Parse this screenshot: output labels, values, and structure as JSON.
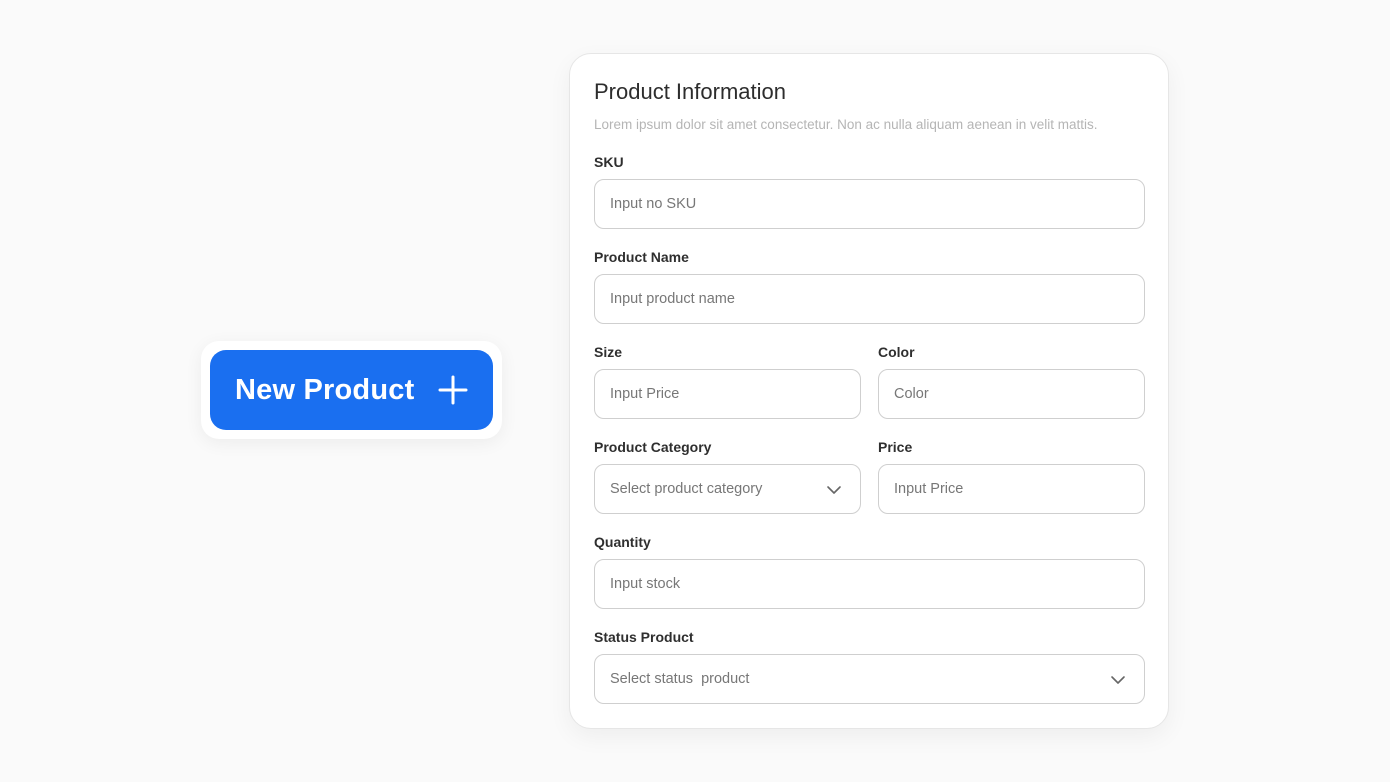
{
  "new_product_button": {
    "label": "New Product",
    "icon": "plus-icon",
    "color": "#1a6ff0"
  },
  "form": {
    "title": "Product Information",
    "subtitle": "Lorem ipsum dolor sit amet consectetur. Non ac nulla aliquam aenean in velit mattis.",
    "fields": {
      "sku": {
        "label": "SKU",
        "placeholder": "Input no SKU"
      },
      "product_name": {
        "label": "Product Name",
        "placeholder": "Input product name"
      },
      "size": {
        "label": "Size",
        "placeholder": "Input Price"
      },
      "color": {
        "label": "Color",
        "placeholder": "Color"
      },
      "category": {
        "label": "Product Category",
        "placeholder": "Select product category",
        "icon": "chevron-down-icon"
      },
      "price": {
        "label": "Price",
        "placeholder": "Input Price"
      },
      "quantity": {
        "label": "Quantity",
        "placeholder": "Input stock"
      },
      "status": {
        "label": "Status Product",
        "placeholder": "Select status  product",
        "icon": "chevron-down-icon"
      }
    }
  }
}
